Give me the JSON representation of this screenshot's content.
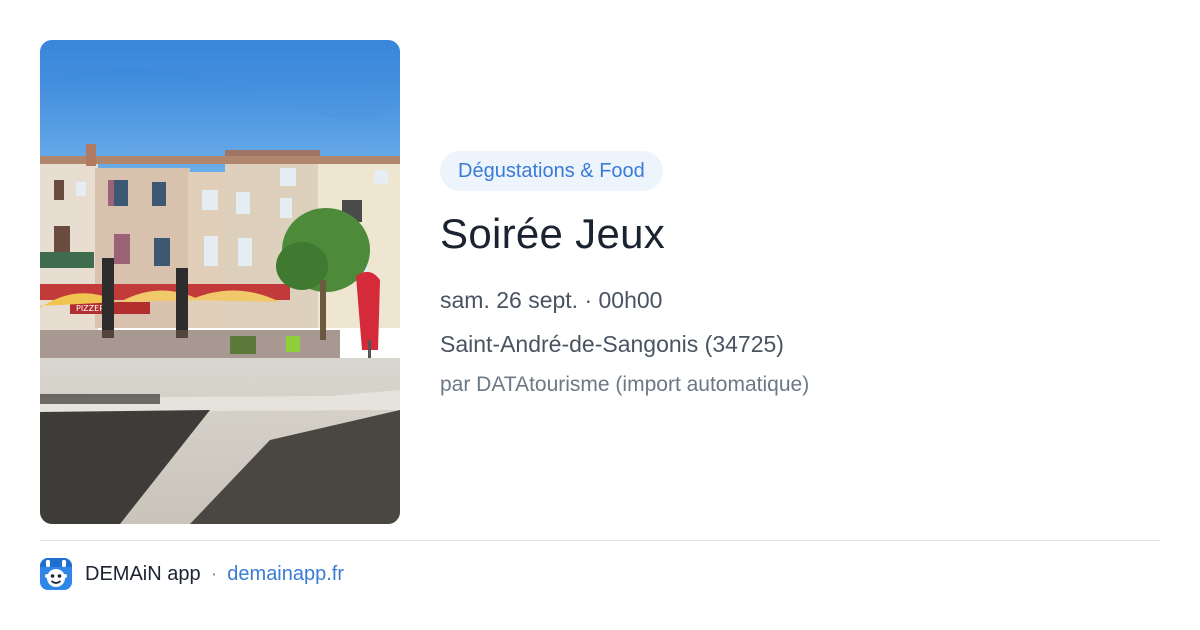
{
  "event": {
    "category": "Dégustations & Food",
    "title": "Soirée Jeux",
    "datetime": "sam. 26 sept. · 00h00",
    "location": "Saint-André-de-Sangonis (34725)",
    "source": "par DATAtourisme (import automatique)"
  },
  "photo": {
    "icon": "photo-village-square",
    "signs": {
      "pizzeria": "PIZZERIA"
    }
  },
  "footer": {
    "app_name": "DEMAiN app",
    "separator": "·",
    "url": "demainapp.fr",
    "icon": "demain-app-icon"
  },
  "colors": {
    "accent": "#3a7bd5",
    "badge_bg": "#eef4fc",
    "title": "#1b2330",
    "text": "#4a5461",
    "muted": "#6c7884",
    "divider": "#dde3e8"
  }
}
